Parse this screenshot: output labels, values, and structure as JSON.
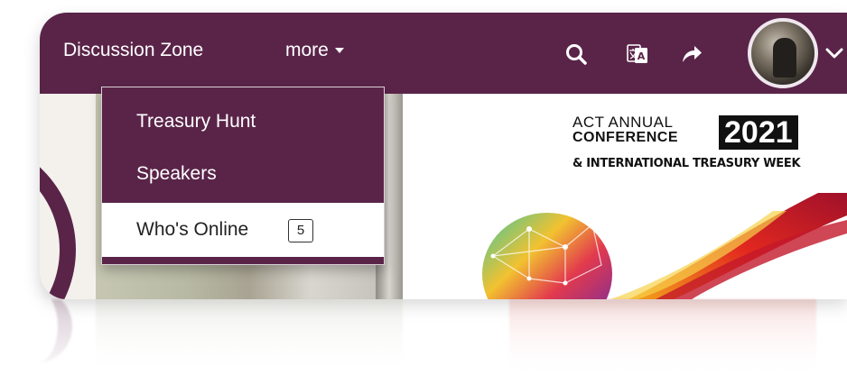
{
  "nav": {
    "discussion_label": "Discussion Zone",
    "more_label": "more",
    "icons": [
      "search-icon",
      "translate-icon",
      "share-icon",
      "chevron-down-icon"
    ],
    "colors": {
      "bar": "#5a2449",
      "text": "#ffffff"
    }
  },
  "dropdown": {
    "items": [
      {
        "label": "Treasury Hunt"
      },
      {
        "label": "Speakers"
      },
      {
        "label": "Who's Online",
        "badge": "5"
      }
    ]
  },
  "banner": {
    "line1": "ACT ANNUAL",
    "line2": "CONFERENCE",
    "year": "2021",
    "line3": "& INTERNATIONAL TREASURY WEEK"
  }
}
